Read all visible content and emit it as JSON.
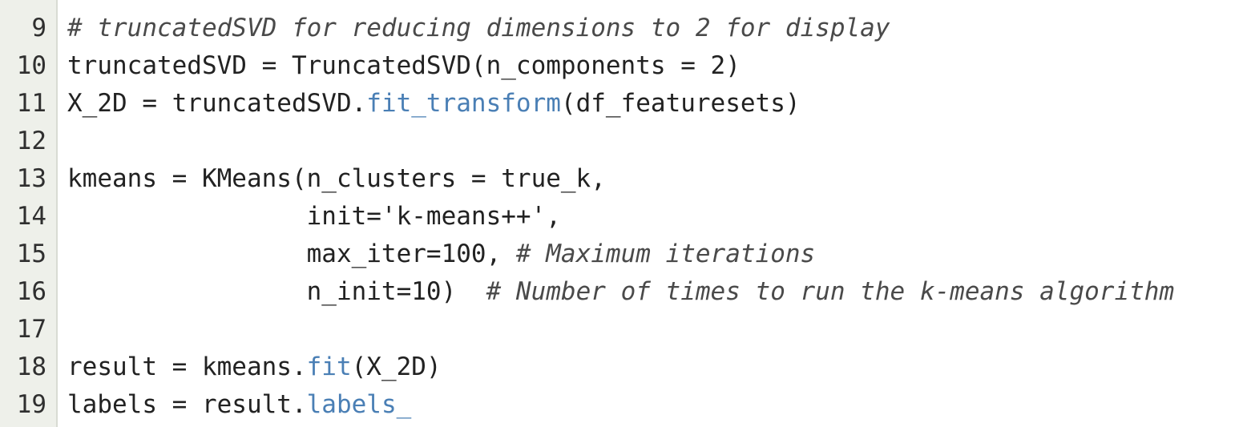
{
  "editor": {
    "colors": {
      "gutter_bg": "#eef0ea",
      "text": "#222222",
      "comment": "#4a4a4a",
      "attribute": "#4a7fb5"
    },
    "lines": [
      {
        "number": "9",
        "segments": [
          {
            "kind": "cm",
            "text": "# truncatedSVD for reducing dimensions to 2 for display"
          }
        ]
      },
      {
        "number": "10",
        "segments": [
          {
            "kind": "pl",
            "text": "truncatedSVD = TruncatedSVD(n_components = 2)"
          }
        ]
      },
      {
        "number": "11",
        "segments": [
          {
            "kind": "pl",
            "text": "X_2D = truncatedSVD."
          },
          {
            "kind": "fn",
            "text": "fit_transform"
          },
          {
            "kind": "pl",
            "text": "(df_featuresets)"
          }
        ]
      },
      {
        "number": "12",
        "segments": [
          {
            "kind": "pl",
            "text": ""
          }
        ]
      },
      {
        "number": "13",
        "segments": [
          {
            "kind": "pl",
            "text": "kmeans = KMeans(n_clusters = true_k,"
          }
        ]
      },
      {
        "number": "14",
        "segments": [
          {
            "kind": "pl",
            "text": "                init='k-means++',"
          }
        ]
      },
      {
        "number": "15",
        "segments": [
          {
            "kind": "pl",
            "text": "                max_iter=100, "
          },
          {
            "kind": "cm",
            "text": "# Maximum iterations"
          }
        ]
      },
      {
        "number": "16",
        "segments": [
          {
            "kind": "pl",
            "text": "                n_init=10)  "
          },
          {
            "kind": "cm",
            "text": "# Number of times to run the k-means algorithm"
          }
        ]
      },
      {
        "number": "17",
        "segments": [
          {
            "kind": "pl",
            "text": ""
          }
        ]
      },
      {
        "number": "18",
        "segments": [
          {
            "kind": "pl",
            "text": "result = kmeans."
          },
          {
            "kind": "fn",
            "text": "fit"
          },
          {
            "kind": "pl",
            "text": "(X_2D)"
          }
        ]
      },
      {
        "number": "19",
        "segments": [
          {
            "kind": "pl",
            "text": "labels = result."
          },
          {
            "kind": "fn",
            "text": "labels_"
          }
        ]
      }
    ]
  }
}
